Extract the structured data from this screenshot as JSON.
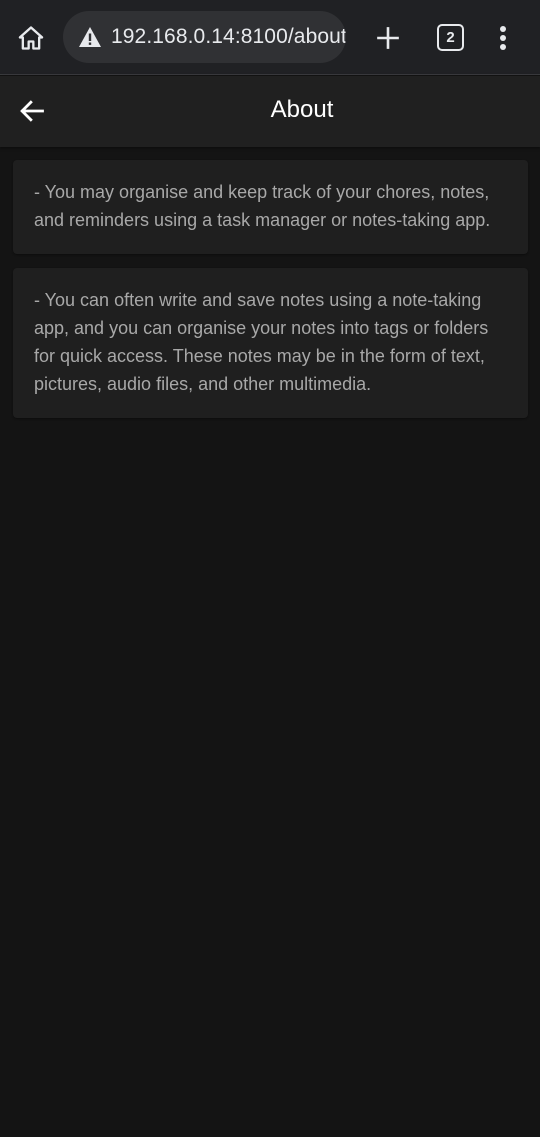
{
  "browser": {
    "url": "192.168.0.14:8100/about",
    "tab_count": "2",
    "icons": {
      "home": "home-icon",
      "warning": "warning-icon",
      "new_tab": "plus-icon",
      "menu": "more-vert-icon"
    }
  },
  "header": {
    "title": "About",
    "back_icon": "arrow-back-icon"
  },
  "cards": [
    {
      "text": "- You may organise and keep track of your chores, notes, and reminders using a task manager or notes-taking app."
    },
    {
      "text": "- You can often write and save notes using a note-taking app, and you can organise your notes into tags or folders for quick access. These notes may be in the form of text, pictures, audio files, and other multimedia."
    }
  ],
  "colors": {
    "background": "#141414",
    "header": "#202020",
    "card": "#1f1f1f",
    "card_text": "#a8a8a8",
    "browser_bar": "#202124",
    "url_pill": "#303134"
  }
}
